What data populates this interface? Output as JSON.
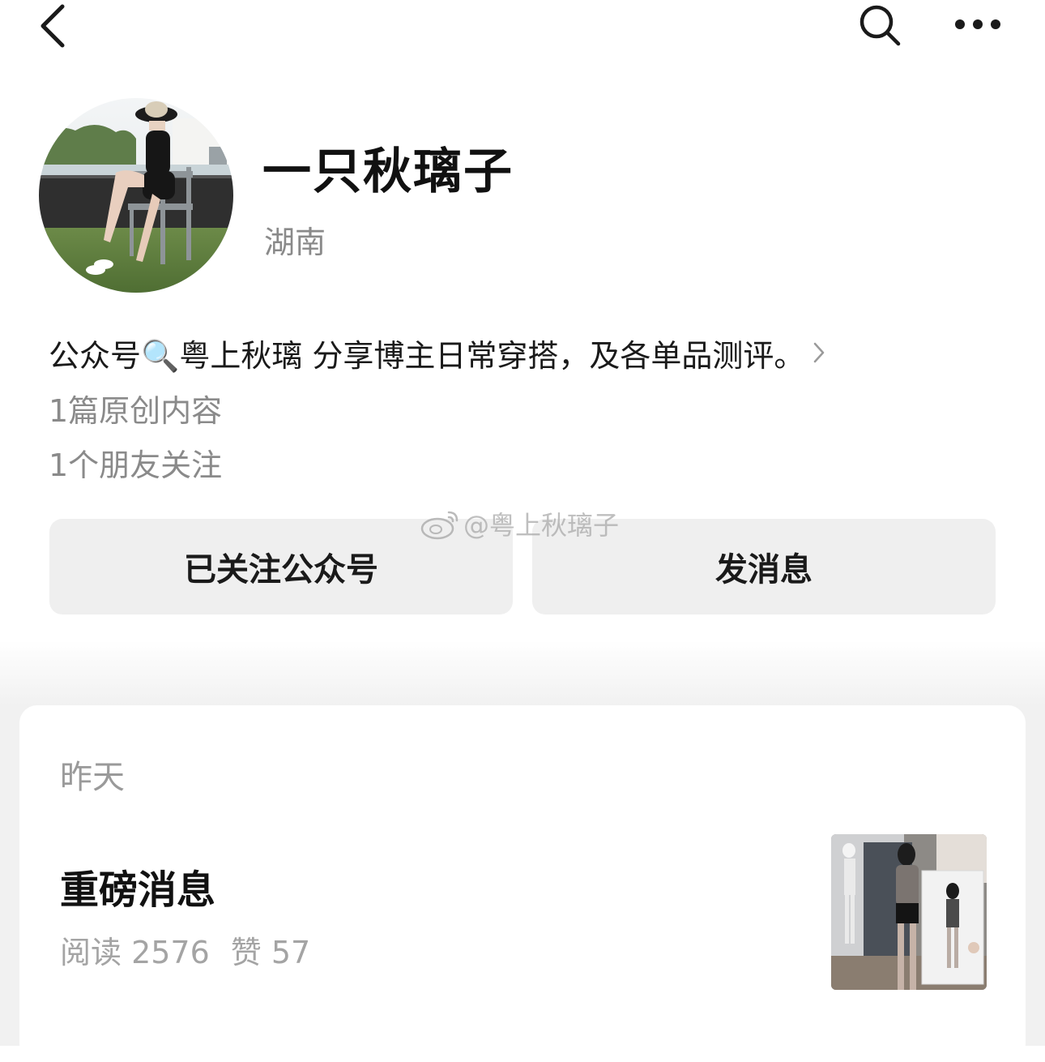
{
  "profile": {
    "name": "一只秋璃子",
    "region": "湖南",
    "bio": "公众号🔍粤上秋璃 分享博主日常穿搭，及各单品测评。",
    "original_count": "1篇原创内容",
    "friends_following": "1个朋友关注",
    "avatar_icon": "profile-photo"
  },
  "actions": {
    "follow_label": "已关注公众号",
    "message_label": "发消息"
  },
  "watermark": {
    "text": "@粤上秋璃子",
    "icon": "weibo-logo"
  },
  "feed": {
    "date": "昨天",
    "article": {
      "title": "重磅消息",
      "reads": "阅读 2576",
      "likes": "赞 57"
    }
  },
  "icons": {
    "back": "chevron-left-icon",
    "search": "search-icon",
    "more": "more-icon",
    "bio_more": "chevron-right-icon"
  },
  "colors": {
    "text_primary": "#1a1a1a",
    "text_secondary": "#8a8a8a",
    "button_bg": "#efefef",
    "feed_bg": "#f1f1f1"
  }
}
